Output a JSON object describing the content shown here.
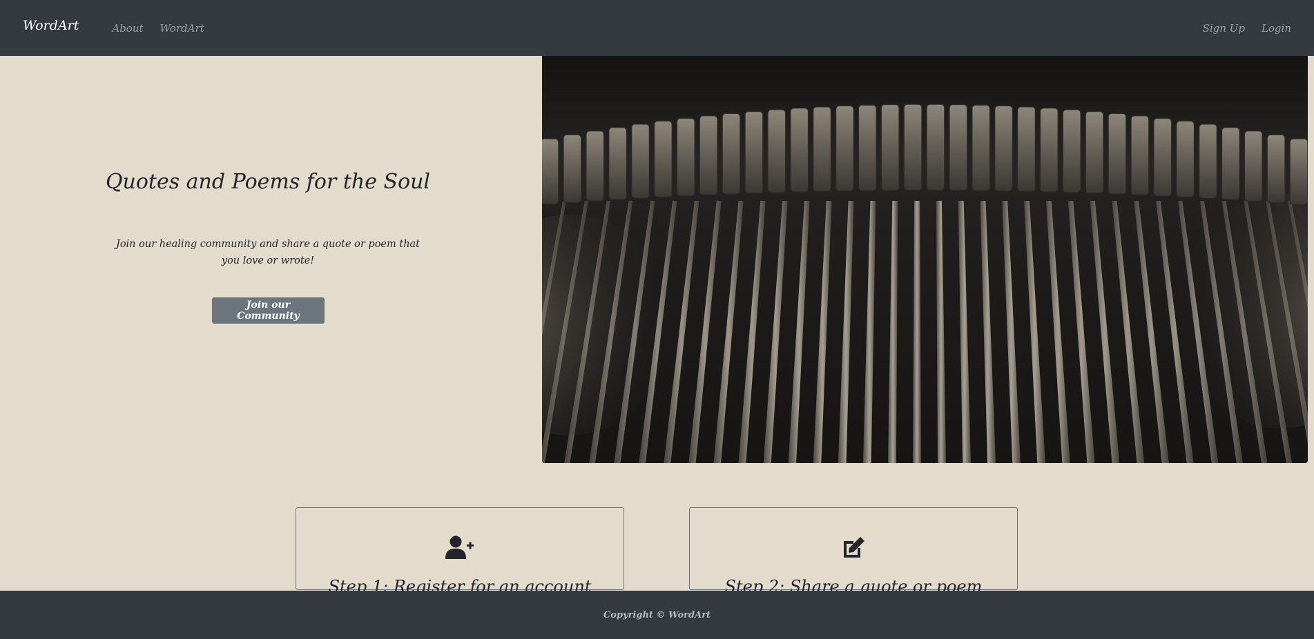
{
  "navbar": {
    "brand": "WordArt",
    "links": [
      "About",
      "WordArt"
    ],
    "right_links": [
      "Sign Up",
      "Login"
    ],
    "background": "#343a40"
  },
  "hero": {
    "title": "Quotes and Poems for the Soul",
    "text": "Join our healing community and share a quote or poem that you love or wrote!",
    "button_label": "Join our Community",
    "image_icon": "typewriter-photo",
    "background": "#e3dbcb"
  },
  "steps": [
    {
      "icon": "user-plus-icon",
      "title": "Step 1: Register for an account"
    },
    {
      "icon": "edit-icon",
      "title": "Step 2: Share a quote or poem"
    }
  ],
  "footer": {
    "text": "Copyright © WordArt"
  }
}
